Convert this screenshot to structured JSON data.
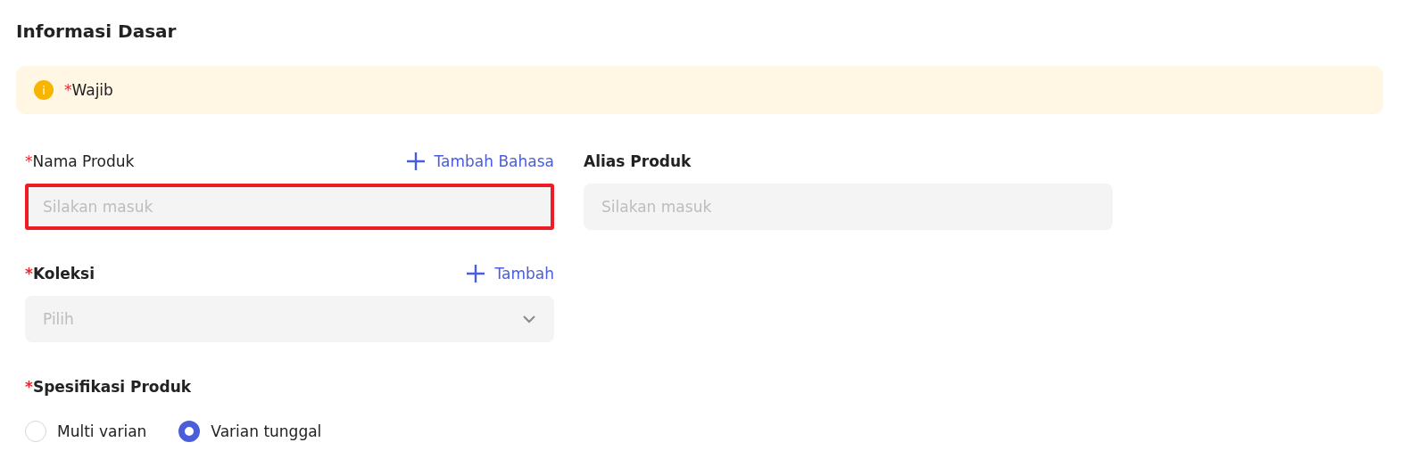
{
  "section_title": "Informasi Dasar",
  "notice": {
    "icon": "i",
    "mark": "*",
    "text": "Wajib"
  },
  "fields": [
    {
      "kind": "input",
      "mark": "*",
      "label": "Nama Produk",
      "bold": false,
      "action": "Tambah Bahasa",
      "placeholder": "Silakan masuk",
      "error": true
    },
    {
      "kind": "input",
      "label": "Alias Produk",
      "bold": true,
      "placeholder": "Silakan masuk",
      "error": false
    },
    {
      "kind": "select",
      "mark": "*",
      "label": "Koleksi",
      "bold": true,
      "action": "Tambah",
      "placeholder": "Pilih",
      "error": false
    }
  ],
  "specification": {
    "mark": "*",
    "label": "Spesifikasi Produk",
    "options": [
      {
        "label": "Multi varian",
        "selected": false
      },
      {
        "label": "Varian tunggal",
        "selected": true
      }
    ]
  }
}
